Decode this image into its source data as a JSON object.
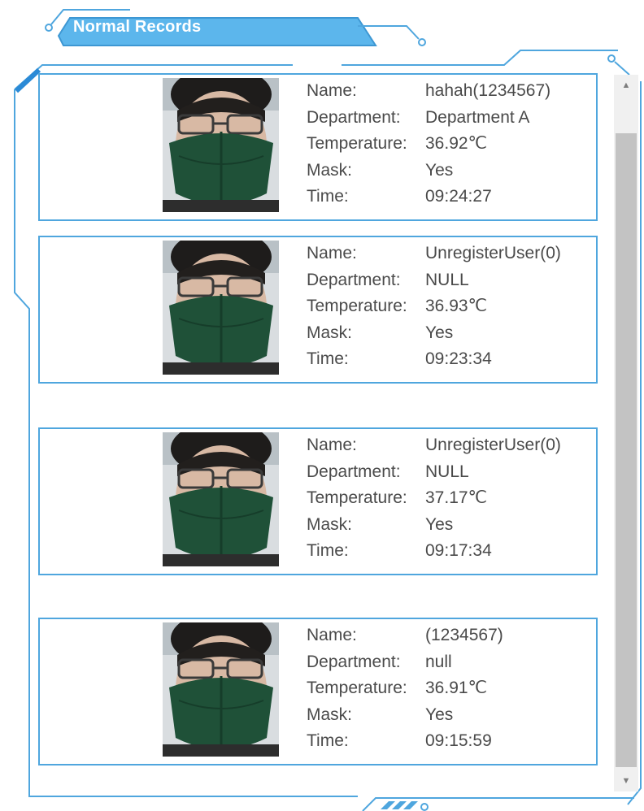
{
  "panel": {
    "title": "Normal Records",
    "accent_color": "#4fa6de",
    "tab_fill": "#5cb6ec"
  },
  "labels": {
    "name": "Name:",
    "department": "Department:",
    "temperature": "Temperature:",
    "mask": "Mask:",
    "time": "Time:"
  },
  "records": [
    {
      "photo_icon": "person-photo",
      "name": "hahah(1234567)",
      "department": "Department A",
      "temperature": "36.92℃",
      "mask": "Yes",
      "time": "09:24:27"
    },
    {
      "photo_icon": "person-photo",
      "name": "UnregisterUser(0)",
      "department": "NULL",
      "temperature": "36.93℃",
      "mask": "Yes",
      "time": "09:23:34"
    },
    {
      "photo_icon": "person-photo",
      "name": "UnregisterUser(0)",
      "department": "NULL",
      "temperature": "37.17℃",
      "mask": "Yes",
      "time": "09:17:34"
    },
    {
      "photo_icon": "person-photo",
      "name": "(1234567)",
      "department": "null",
      "temperature": "36.91℃",
      "mask": "Yes",
      "time": "09:15:59"
    }
  ],
  "scrollbar": {
    "up_icon": "arrow-up-icon",
    "down_icon": "arrow-down-icon"
  }
}
